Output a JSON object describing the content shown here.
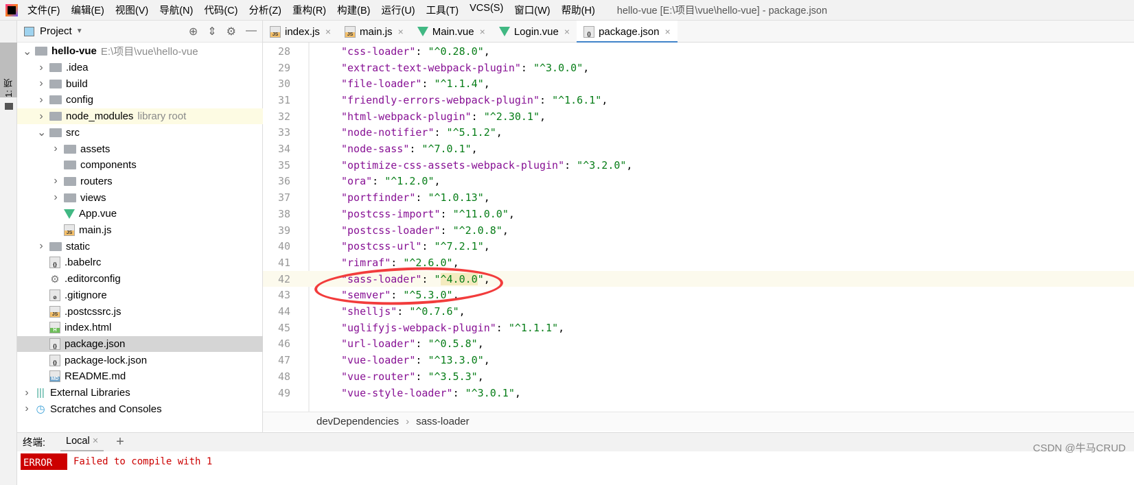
{
  "menubar": {
    "items": [
      "文件(F)",
      "编辑(E)",
      "视图(V)",
      "导航(N)",
      "代码(C)",
      "分析(Z)",
      "重构(R)",
      "构建(B)",
      "运行(U)",
      "工具(T)",
      "VCS(S)",
      "窗口(W)",
      "帮助(H)"
    ],
    "window_title": "hello-vue [E:\\项目\\vue\\hello-vue] - package.json"
  },
  "strip": {
    "label": "1: 项目"
  },
  "project": {
    "title": "Project",
    "tree": [
      {
        "label": "hello-vue",
        "hint": "E:\\项目\\vue\\hello-vue",
        "type": "module",
        "depth": 0,
        "chev": "v",
        "bold": true
      },
      {
        "label": ".idea",
        "type": "folder",
        "depth": 1,
        "chev": ">"
      },
      {
        "label": "build",
        "type": "folder",
        "depth": 1,
        "chev": ">"
      },
      {
        "label": "config",
        "type": "folder",
        "depth": 1,
        "chev": ">"
      },
      {
        "label": "node_modules",
        "hint": "library root",
        "type": "folder",
        "depth": 1,
        "chev": ">",
        "lib": true
      },
      {
        "label": "src",
        "type": "folder",
        "depth": 1,
        "chev": "v"
      },
      {
        "label": "assets",
        "type": "folder",
        "depth": 2,
        "chev": ">"
      },
      {
        "label": "components",
        "type": "folder",
        "depth": 2,
        "chev": ""
      },
      {
        "label": "routers",
        "type": "folder",
        "depth": 2,
        "chev": ">"
      },
      {
        "label": "views",
        "type": "folder",
        "depth": 2,
        "chev": ">"
      },
      {
        "label": "App.vue",
        "type": "vue",
        "depth": 2,
        "chev": ""
      },
      {
        "label": "main.js",
        "type": "js",
        "depth": 2,
        "chev": ""
      },
      {
        "label": "static",
        "type": "folder",
        "depth": 1,
        "chev": ">"
      },
      {
        "label": ".babelrc",
        "type": "json",
        "depth": 1,
        "chev": ""
      },
      {
        "label": ".editorconfig",
        "type": "gear",
        "depth": 1,
        "chev": ""
      },
      {
        "label": ".gitignore",
        "type": "ignore",
        "depth": 1,
        "chev": ""
      },
      {
        "label": ".postcssrc.js",
        "type": "js",
        "depth": 1,
        "chev": ""
      },
      {
        "label": "index.html",
        "type": "html",
        "depth": 1,
        "chev": ""
      },
      {
        "label": "package.json",
        "type": "json",
        "depth": 1,
        "chev": "",
        "selected": true
      },
      {
        "label": "package-lock.json",
        "type": "json",
        "depth": 1,
        "chev": ""
      },
      {
        "label": "README.md",
        "type": "md",
        "depth": 1,
        "chev": ""
      },
      {
        "label": "External Libraries",
        "type": "libs",
        "depth": 0,
        "chev": ">"
      },
      {
        "label": "Scratches and Consoles",
        "type": "scratch",
        "depth": 0,
        "chev": ">"
      }
    ]
  },
  "tabs": [
    {
      "label": "index.js",
      "icon": "js"
    },
    {
      "label": "main.js",
      "icon": "js"
    },
    {
      "label": "Main.vue",
      "icon": "vue"
    },
    {
      "label": "Login.vue",
      "icon": "vue"
    },
    {
      "label": "package.json",
      "icon": "json",
      "active": true
    }
  ],
  "code": [
    {
      "n": "28",
      "k": "css-loader",
      "v": "^0.28.0"
    },
    {
      "n": "29",
      "k": "extract-text-webpack-plugin",
      "v": "^3.0.0"
    },
    {
      "n": "30",
      "k": "file-loader",
      "v": "^1.1.4"
    },
    {
      "n": "31",
      "k": "friendly-errors-webpack-plugin",
      "v": "^1.6.1"
    },
    {
      "n": "32",
      "k": "html-webpack-plugin",
      "v": "^2.30.1"
    },
    {
      "n": "33",
      "k": "node-notifier",
      "v": "^5.1.2"
    },
    {
      "n": "34",
      "k": "node-sass",
      "v": "^7.0.1"
    },
    {
      "n": "35",
      "k": "optimize-css-assets-webpack-plugin",
      "v": "^3.2.0"
    },
    {
      "n": "36",
      "k": "ora",
      "v": "^1.2.0"
    },
    {
      "n": "37",
      "k": "portfinder",
      "v": "^1.0.13"
    },
    {
      "n": "38",
      "k": "postcss-import",
      "v": "^11.0.0"
    },
    {
      "n": "39",
      "k": "postcss-loader",
      "v": "^2.0.8"
    },
    {
      "n": "40",
      "k": "postcss-url",
      "v": "^7.2.1"
    },
    {
      "n": "41",
      "k": "rimraf",
      "v": "^2.6.0"
    },
    {
      "n": "42",
      "k": "sass-loader",
      "v": "^4.0.0",
      "current": true
    },
    {
      "n": "43",
      "k": "semver",
      "v": "^5.3.0"
    },
    {
      "n": "44",
      "k": "shelljs",
      "v": "^0.7.6"
    },
    {
      "n": "45",
      "k": "uglifyjs-webpack-plugin",
      "v": "^1.1.1"
    },
    {
      "n": "46",
      "k": "url-loader",
      "v": "^0.5.8"
    },
    {
      "n": "47",
      "k": "vue-loader",
      "v": "^13.3.0"
    },
    {
      "n": "48",
      "k": "vue-router",
      "v": "^3.5.3"
    },
    {
      "n": "49",
      "k": "vue-style-loader",
      "v": "^3.0.1"
    }
  ],
  "breadcrumb": [
    "devDependencies",
    "sass-loader"
  ],
  "terminal": {
    "label": "终端:",
    "tab": "Local",
    "error_badge": "ERROR",
    "error_text": "Failed to compile with 1"
  },
  "watermark": "CSDN @牛马CRUD",
  "colors": {
    "accent": "#4083c9",
    "annotation": "#f23c3c",
    "key": "#871094",
    "string": "#067d17"
  }
}
